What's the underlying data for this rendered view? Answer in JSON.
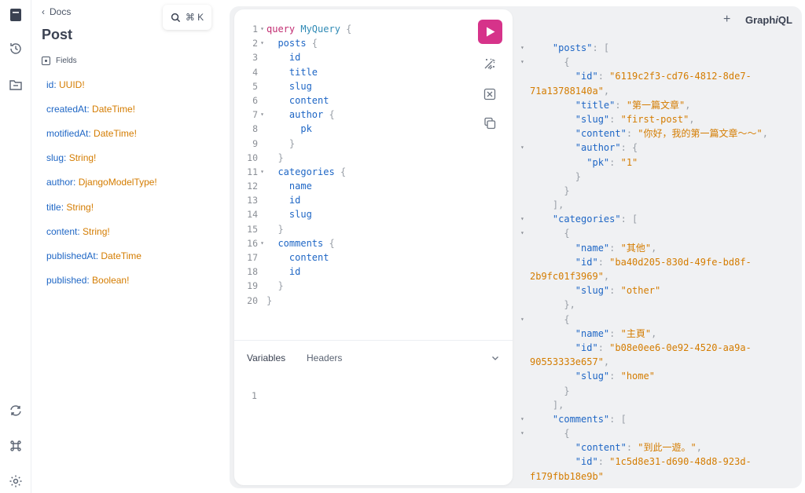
{
  "sidebar": {
    "icons": [
      "docs-icon",
      "history-icon",
      "explorer-icon",
      "refetch-schema-icon",
      "shortcuts-icon",
      "settings-icon"
    ]
  },
  "docs": {
    "back_label": "Docs",
    "title": "Post",
    "search_shortcut": "⌘ K",
    "fields_header": "Fields",
    "fields": [
      {
        "name": "id",
        "type": "UUID!"
      },
      {
        "name": "createdAt",
        "type": "DateTime!"
      },
      {
        "name": "motifiedAt",
        "type": "DateTime!"
      },
      {
        "name": "slug",
        "type": "String!"
      },
      {
        "name": "author",
        "type": "DjangoModelType!"
      },
      {
        "name": "title",
        "type": "String!"
      },
      {
        "name": "content",
        "type": "String!"
      },
      {
        "name": "publishedAt",
        "type": "DateTime"
      },
      {
        "name": "published",
        "type": "Boolean!"
      }
    ]
  },
  "editor": {
    "lines": [
      {
        "n": "1",
        "fold": "▾",
        "code": [
          {
            "t": "query",
            "c": "kw"
          },
          {
            "t": " "
          },
          {
            "t": "MyQuery",
            "c": "op"
          },
          {
            "t": " {",
            "c": "p"
          }
        ]
      },
      {
        "n": "2",
        "fold": "▾",
        "code": [
          {
            "t": "  posts"
          },
          {
            "t": " {",
            "c": "p"
          }
        ]
      },
      {
        "n": "3",
        "fold": "",
        "code": [
          {
            "t": "    id"
          }
        ]
      },
      {
        "n": "4",
        "fold": "",
        "code": [
          {
            "t": "    title"
          }
        ]
      },
      {
        "n": "5",
        "fold": "",
        "code": [
          {
            "t": "    slug"
          }
        ]
      },
      {
        "n": "6",
        "fold": "",
        "code": [
          {
            "t": "    content"
          }
        ]
      },
      {
        "n": "7",
        "fold": "▾",
        "code": [
          {
            "t": "    author"
          },
          {
            "t": " {",
            "c": "p"
          }
        ]
      },
      {
        "n": "8",
        "fold": "",
        "code": [
          {
            "t": "      pk"
          }
        ]
      },
      {
        "n": "9",
        "fold": "",
        "code": [
          {
            "t": "    }",
            "c": "p"
          }
        ]
      },
      {
        "n": "10",
        "fold": "",
        "code": [
          {
            "t": "  }",
            "c": "p"
          }
        ]
      },
      {
        "n": "11",
        "fold": "▾",
        "code": [
          {
            "t": "  categories"
          },
          {
            "t": " {",
            "c": "p"
          }
        ]
      },
      {
        "n": "12",
        "fold": "",
        "code": [
          {
            "t": "    name"
          }
        ]
      },
      {
        "n": "13",
        "fold": "",
        "code": [
          {
            "t": "    id"
          }
        ]
      },
      {
        "n": "14",
        "fold": "",
        "code": [
          {
            "t": "    slug"
          }
        ]
      },
      {
        "n": "15",
        "fold": "",
        "code": [
          {
            "t": "  }",
            "c": "p"
          }
        ]
      },
      {
        "n": "16",
        "fold": "▾",
        "code": [
          {
            "t": "  comments"
          },
          {
            "t": " {",
            "c": "p"
          }
        ]
      },
      {
        "n": "17",
        "fold": "",
        "code": [
          {
            "t": "    content"
          }
        ]
      },
      {
        "n": "18",
        "fold": "",
        "code": [
          {
            "t": "    id"
          }
        ]
      },
      {
        "n": "19",
        "fold": "",
        "code": [
          {
            "t": "  }",
            "c": "p"
          }
        ]
      },
      {
        "n": "20",
        "fold": "",
        "code": [
          {
            "t": "}",
            "c": "p"
          }
        ]
      }
    ],
    "tools": [
      "prettify-icon",
      "merge-fragments-icon",
      "copy-query-icon"
    ]
  },
  "variables": {
    "tabs": [
      "Variables",
      "Headers"
    ],
    "line_number": "1"
  },
  "header": {
    "plus": "+",
    "brand_prefix": "Graph",
    "brand_italic": "i",
    "brand_suffix": "QL"
  },
  "result": {
    "lines": [
      {
        "fold": "▾",
        "parts": [
          {
            "t": "    "
          },
          {
            "t": "\"posts\"",
            "c": "rk"
          },
          {
            "t": ": [",
            "c": "rt"
          }
        ]
      },
      {
        "fold": "▾",
        "parts": [
          {
            "t": "      {",
            "c": "rt"
          }
        ]
      },
      {
        "fold": "",
        "parts": [
          {
            "t": "        "
          },
          {
            "t": "\"id\"",
            "c": "rk"
          },
          {
            "t": ": ",
            "c": "rt"
          },
          {
            "t": "\"6119c2f3-cd76-4812-8de7-",
            "c": "rs"
          }
        ]
      },
      {
        "fold": "",
        "parts": [
          {
            "t": "71a13788140a\"",
            "c": "rs"
          },
          {
            "t": ",",
            "c": "rt"
          }
        ]
      },
      {
        "fold": "",
        "parts": [
          {
            "t": "        "
          },
          {
            "t": "\"title\"",
            "c": "rk"
          },
          {
            "t": ": ",
            "c": "rt"
          },
          {
            "t": "\"第一篇文章\"",
            "c": "rs"
          },
          {
            "t": ",",
            "c": "rt"
          }
        ]
      },
      {
        "fold": "",
        "parts": [
          {
            "t": "        "
          },
          {
            "t": "\"slug\"",
            "c": "rk"
          },
          {
            "t": ": ",
            "c": "rt"
          },
          {
            "t": "\"first-post\"",
            "c": "rs"
          },
          {
            "t": ",",
            "c": "rt"
          }
        ]
      },
      {
        "fold": "",
        "parts": [
          {
            "t": "        "
          },
          {
            "t": "\"content\"",
            "c": "rk"
          },
          {
            "t": ": ",
            "c": "rt"
          },
          {
            "t": "\"你好，我的第一篇文章～～\"",
            "c": "rs"
          },
          {
            "t": ",",
            "c": "rt"
          }
        ]
      },
      {
        "fold": "▾",
        "parts": [
          {
            "t": "        "
          },
          {
            "t": "\"author\"",
            "c": "rk"
          },
          {
            "t": ": {",
            "c": "rt"
          }
        ]
      },
      {
        "fold": "",
        "parts": [
          {
            "t": "          "
          },
          {
            "t": "\"pk\"",
            "c": "rk"
          },
          {
            "t": ": ",
            "c": "rt"
          },
          {
            "t": "\"1\"",
            "c": "rs"
          }
        ]
      },
      {
        "fold": "",
        "parts": [
          {
            "t": "        }",
            "c": "rt"
          }
        ]
      },
      {
        "fold": "",
        "parts": [
          {
            "t": "      }",
            "c": "rt"
          }
        ]
      },
      {
        "fold": "",
        "parts": [
          {
            "t": "    ],",
            "c": "rt"
          }
        ]
      },
      {
        "fold": "▾",
        "parts": [
          {
            "t": "    "
          },
          {
            "t": "\"categories\"",
            "c": "rk"
          },
          {
            "t": ": [",
            "c": "rt"
          }
        ]
      },
      {
        "fold": "▾",
        "parts": [
          {
            "t": "      {",
            "c": "rt"
          }
        ]
      },
      {
        "fold": "",
        "parts": [
          {
            "t": "        "
          },
          {
            "t": "\"name\"",
            "c": "rk"
          },
          {
            "t": ": ",
            "c": "rt"
          },
          {
            "t": "\"其他\"",
            "c": "rs"
          },
          {
            "t": ",",
            "c": "rt"
          }
        ]
      },
      {
        "fold": "",
        "parts": [
          {
            "t": "        "
          },
          {
            "t": "\"id\"",
            "c": "rk"
          },
          {
            "t": ": ",
            "c": "rt"
          },
          {
            "t": "\"ba40d205-830d-49fe-bd8f-",
            "c": "rs"
          }
        ]
      },
      {
        "fold": "",
        "parts": [
          {
            "t": "2b9fc01f3969\"",
            "c": "rs"
          },
          {
            "t": ",",
            "c": "rt"
          }
        ]
      },
      {
        "fold": "",
        "parts": [
          {
            "t": "        "
          },
          {
            "t": "\"slug\"",
            "c": "rk"
          },
          {
            "t": ": ",
            "c": "rt"
          },
          {
            "t": "\"other\"",
            "c": "rs"
          }
        ]
      },
      {
        "fold": "",
        "parts": [
          {
            "t": "      },",
            "c": "rt"
          }
        ]
      },
      {
        "fold": "▾",
        "parts": [
          {
            "t": "      {",
            "c": "rt"
          }
        ]
      },
      {
        "fold": "",
        "parts": [
          {
            "t": "        "
          },
          {
            "t": "\"name\"",
            "c": "rk"
          },
          {
            "t": ": ",
            "c": "rt"
          },
          {
            "t": "\"主頁\"",
            "c": "rs"
          },
          {
            "t": ",",
            "c": "rt"
          }
        ]
      },
      {
        "fold": "",
        "parts": [
          {
            "t": "        "
          },
          {
            "t": "\"id\"",
            "c": "rk"
          },
          {
            "t": ": ",
            "c": "rt"
          },
          {
            "t": "\"b08e0ee6-0e92-4520-aa9a-",
            "c": "rs"
          }
        ]
      },
      {
        "fold": "",
        "parts": [
          {
            "t": "90553333e657\"",
            "c": "rs"
          },
          {
            "t": ",",
            "c": "rt"
          }
        ]
      },
      {
        "fold": "",
        "parts": [
          {
            "t": "        "
          },
          {
            "t": "\"slug\"",
            "c": "rk"
          },
          {
            "t": ": ",
            "c": "rt"
          },
          {
            "t": "\"home\"",
            "c": "rs"
          }
        ]
      },
      {
        "fold": "",
        "parts": [
          {
            "t": "      }",
            "c": "rt"
          }
        ]
      },
      {
        "fold": "",
        "parts": [
          {
            "t": "    ],",
            "c": "rt"
          }
        ]
      },
      {
        "fold": "▾",
        "parts": [
          {
            "t": "    "
          },
          {
            "t": "\"comments\"",
            "c": "rk"
          },
          {
            "t": ": [",
            "c": "rt"
          }
        ]
      },
      {
        "fold": "▾",
        "parts": [
          {
            "t": "      {",
            "c": "rt"
          }
        ]
      },
      {
        "fold": "",
        "parts": [
          {
            "t": "        "
          },
          {
            "t": "\"content\"",
            "c": "rk"
          },
          {
            "t": ": ",
            "c": "rt"
          },
          {
            "t": "\"到此一遊。\"",
            "c": "rs"
          },
          {
            "t": ",",
            "c": "rt"
          }
        ]
      },
      {
        "fold": "",
        "parts": [
          {
            "t": "        "
          },
          {
            "t": "\"id\"",
            "c": "rk"
          },
          {
            "t": ": ",
            "c": "rt"
          },
          {
            "t": "\"1c5d8e31-d690-48d8-923d-",
            "c": "rs"
          }
        ]
      },
      {
        "fold": "",
        "parts": [
          {
            "t": "f179fbb18e9b\"",
            "c": "rs"
          }
        ]
      },
      {
        "fold": "",
        "parts": [
          {
            "t": "      }",
            "c": "rt"
          }
        ]
      }
    ]
  },
  "colors": {
    "accent": "#d6338a",
    "field_name": "#1e66c5",
    "field_type": "#d47c00",
    "panel_bg": "#f0f1f3"
  }
}
